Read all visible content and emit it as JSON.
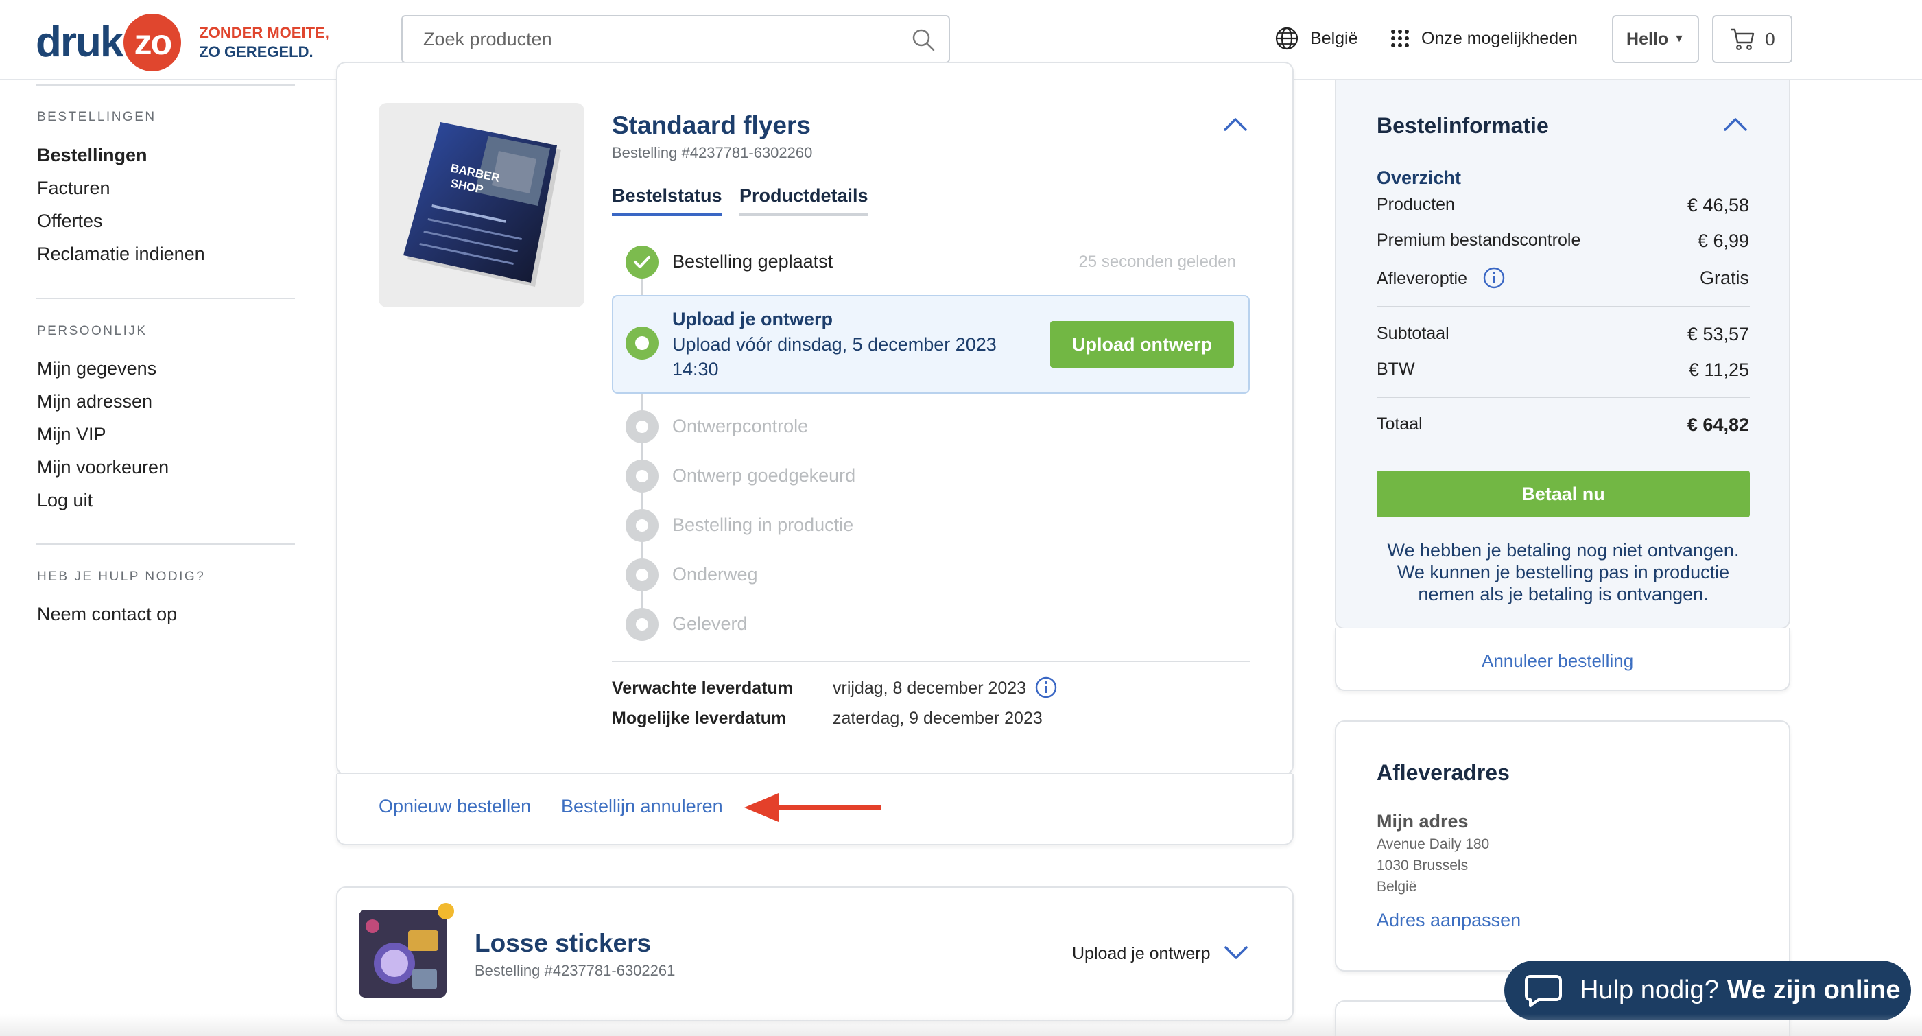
{
  "header": {
    "logo_main": "druk",
    "logo_circle": "zo",
    "logo_tagline_1": "ZONDER MOEITE,",
    "logo_tagline_2": "ZO GEREGELD.",
    "search_placeholder": "Zoek producten",
    "country": "België",
    "options": "Onze mogelijkheden",
    "account_label": "Hello",
    "cart_count": "0",
    "icons": [
      "search-icon",
      "globe-icon",
      "grid-dots-icon",
      "caret-down-icon",
      "cart-icon"
    ]
  },
  "sidebar": {
    "section_orders": "BESTELLINGEN",
    "orders_items": [
      "Bestellingen",
      "Facturen",
      "Offertes",
      "Reclamatie indienen"
    ],
    "section_personal": "PERSOONLIJK",
    "personal_items": [
      "Mijn gegevens",
      "Mijn adressen",
      "Mijn VIP",
      "Mijn voorkeuren",
      "Log uit"
    ],
    "section_help": "HEB JE HULP NODIG?",
    "help_items": [
      "Neem contact op"
    ]
  },
  "order1": {
    "title": "Standaard flyers",
    "order_number": "Bestelling #4237781-6302260",
    "tabs": [
      "Bestelstatus",
      "Productdetails"
    ],
    "steps": [
      {
        "label": "Bestelling geplaatst",
        "time": "25 seconden geleden",
        "state": "done"
      },
      {
        "label": "Upload je ontwerp",
        "state": "current"
      },
      {
        "label": "Ontwerpcontrole",
        "state": "pending"
      },
      {
        "label": "Ontwerp goedgekeurd",
        "state": "pending"
      },
      {
        "label": "Bestelling in productie",
        "state": "pending"
      },
      {
        "label": "Onderweg",
        "state": "pending"
      },
      {
        "label": "Geleverd",
        "state": "pending"
      }
    ],
    "upload_text": "Upload vóór dinsdag, 5 december 2023 14:30",
    "upload_button": "Upload ontwerp",
    "expected_label": "Verwachte leverdatum",
    "expected_value": "vrijdag, 8 december 2023",
    "possible_label": "Mogelijke leverdatum",
    "possible_value": "zaterdag, 9 december 2023",
    "reorder_link": "Opnieuw bestellen",
    "cancel_line_link": "Bestellijn annuleren",
    "flyer_image": {
      "line1": "BARBER",
      "line2": "SHOP"
    }
  },
  "order2": {
    "title": "Losse stickers",
    "order_number": "Bestelling #4237781-6302261",
    "status": "Upload je ontwerp"
  },
  "order_info": {
    "title": "Bestelinformatie",
    "overview_label": "Overzicht",
    "rows": [
      {
        "label": "Producten",
        "value": "€ 46,58"
      },
      {
        "label": "Premium bestandscontrole",
        "value": "€ 6,99"
      },
      {
        "label": "Afleveroptie",
        "value": "Gratis"
      }
    ],
    "subtotal_label": "Subtotaal",
    "subtotal_value": "€ 53,57",
    "vat_label": "BTW",
    "vat_value": "€ 11,25",
    "total_label": "Totaal",
    "total_value": "€ 64,82",
    "pay_button": "Betaal nu",
    "payment_note": "We hebben je betaling nog niet ontvangen. We kunnen je bestelling pas in productie nemen als je betaling is ontvangen.",
    "cancel_order": "Annuleer bestelling"
  },
  "address": {
    "title": "Afleveradres",
    "name": "Mijn adres",
    "street": "Avenue Daily 180",
    "city": "1030 Brussels",
    "country": "België",
    "edit_link": "Adres aanpassen"
  },
  "chat": {
    "text_prefix": "Hulp nodig?",
    "text_bold": "We zijn online"
  },
  "colors": {
    "brand_navy": "#1d4575",
    "brand_orange": "#e0462e",
    "accent_green": "#72b744",
    "link_blue": "#3d6fc1",
    "annotation_arrow": "#e4402a"
  }
}
